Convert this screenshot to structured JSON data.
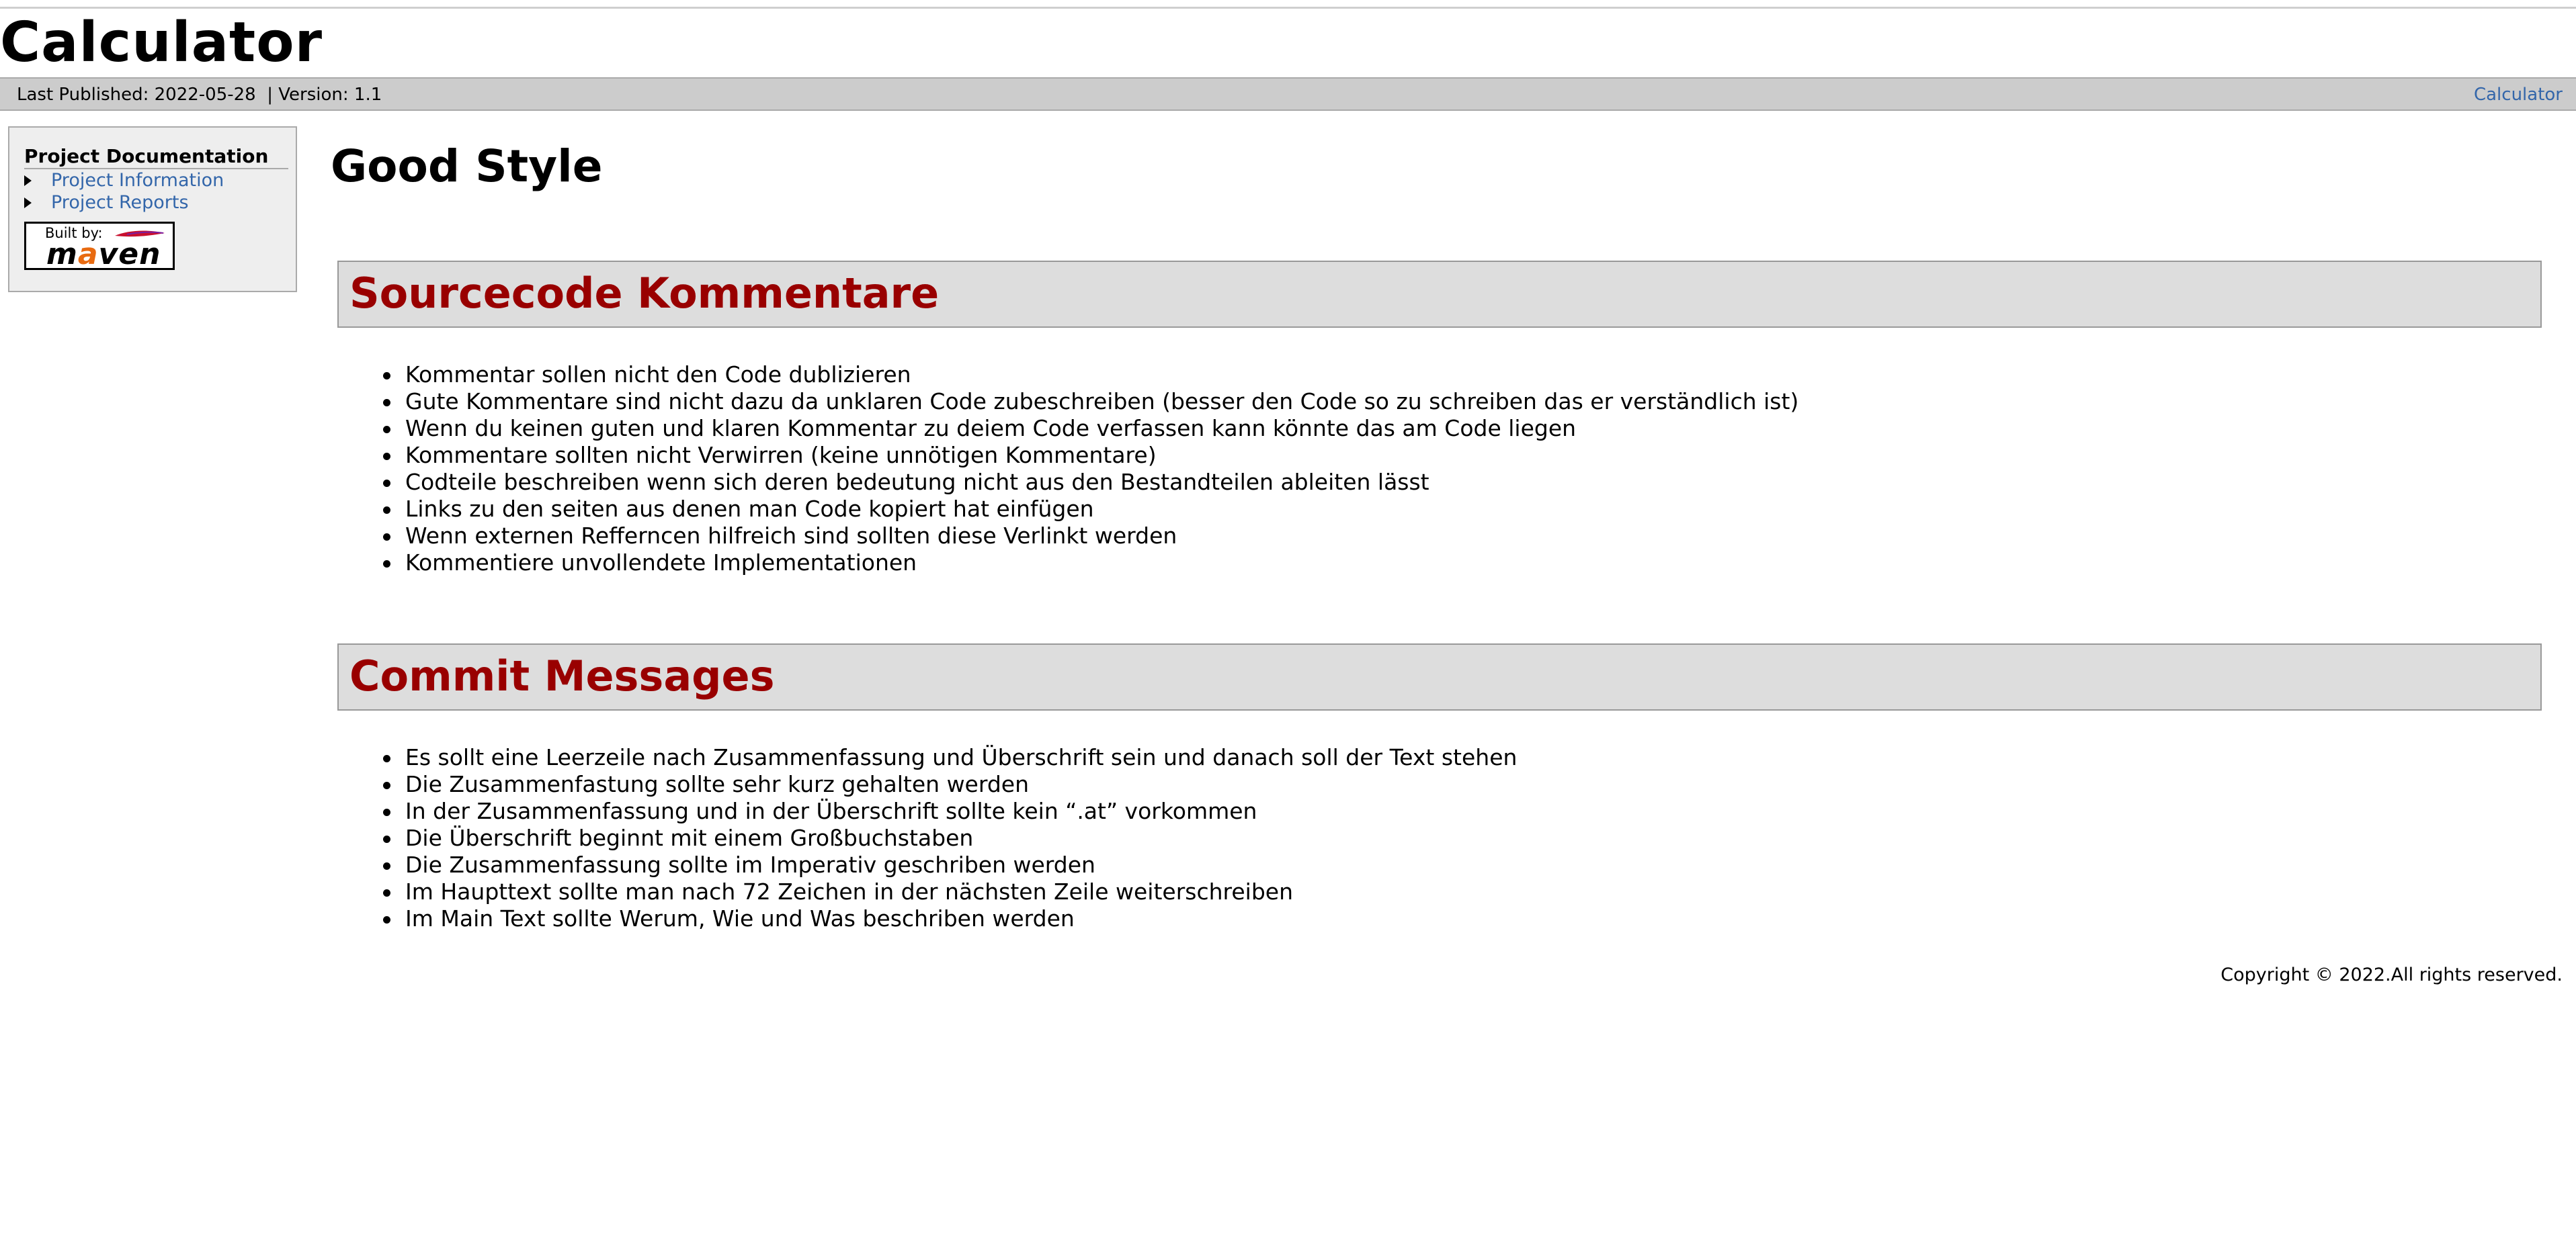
{
  "banner": {
    "title": "Calculator"
  },
  "breadcrumbs": {
    "published": "Last Published: 2022-05-28  | Version: 1.1",
    "right_link": "Calculator"
  },
  "sidebar": {
    "heading": "Project Documentation",
    "items": [
      {
        "label": "Project Information"
      },
      {
        "label": "Project Reports"
      }
    ],
    "badge": {
      "built_by": "Built by:",
      "word_pre": "m",
      "word_accent": "a",
      "word_post": "ven"
    }
  },
  "main": {
    "title": "Good Style",
    "sections": [
      {
        "heading": "Sourcecode Kommentare",
        "items": [
          "Kommentar sollen nicht den Code dublizieren",
          "Gute Kommentare sind nicht dazu da unklaren Code zubeschreiben (besser den Code so zu schreiben das er verständlich ist)",
          "Wenn du keinen guten und klaren Kommentar zu deiem Code verfassen kann könnte das am Code liegen",
          "Kommentare sollten nicht Verwirren (keine unnötigen Kommentare)",
          "Codteile beschreiben wenn sich deren bedeutung nicht aus den Bestandteilen ableiten lässt",
          "Links zu den seiten aus denen man Code kopiert hat einfügen",
          "Wenn externen Refferncen hilfreich sind sollten diese Verlinkt werden",
          "Kommentiere unvollendete Implementationen"
        ]
      },
      {
        "heading": "Commit Messages",
        "items": [
          "Es sollt eine Leerzeile nach Zusammenfassung und Überschrift sein und danach soll der Text stehen",
          "Die Zusammenfastung sollte sehr kurz gehalten werden",
          "In der Zusammenfassung und in der Überschrift sollte kein “.at” vorkommen",
          "Die Überschrift beginnt mit einem Großbuchstaben",
          "Die Zusammenfassung sollte im Imperativ geschriben werden",
          "Im Haupttext sollte man nach 72 Zeichen in der nächsten Zeile weiterschreiben",
          "Im Main Text sollte Werum, Wie und Was beschriben werden"
        ]
      }
    ]
  },
  "footer": {
    "copyright": "Copyright © 2022.All rights reserved."
  },
  "colors": {
    "section_heading": "#990000",
    "link": "#3366aa",
    "breadcrumb_bg": "#cccccc",
    "sidebar_bg": "#eeeeee"
  }
}
